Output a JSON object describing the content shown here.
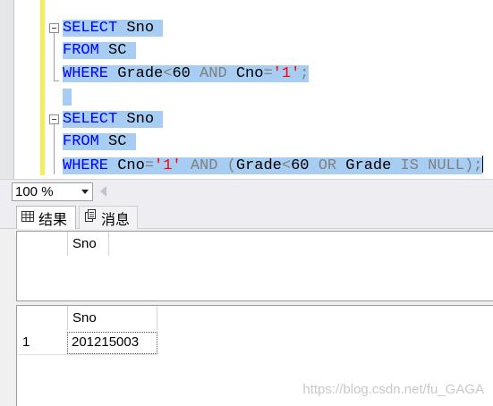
{
  "editor": {
    "block1": {
      "line1": {
        "kw": "SELECT",
        "rest": " Sno "
      },
      "line2": {
        "kw": "FROM",
        "rest": " SC "
      },
      "line3": {
        "kw": "WHERE",
        "t1": " Grade",
        "op1": "<",
        "t2": "60 ",
        "kw2": "AND",
        "t3": " Cno",
        "op2": "=",
        "str": "'1'",
        "op3": ";"
      }
    },
    "block2": {
      "line1": {
        "kw": "SELECT",
        "rest": " Sno "
      },
      "line2": {
        "kw": "FROM",
        "rest": " SC "
      },
      "line3": {
        "kw": "WHERE",
        "t1": " Cno",
        "op1": "=",
        "str": "'1'",
        "sp1": " ",
        "kw2": "AND",
        "op2": " (",
        "t2": "Grade",
        "op3": "<",
        "t3": "60 ",
        "kw3": "OR",
        "t4": " Grade ",
        "kw4": "IS NULL",
        "op4": ");"
      }
    }
  },
  "status": {
    "zoom": "100 %"
  },
  "tabs": {
    "results": "结果",
    "messages": "消息"
  },
  "results": {
    "grid1": {
      "columns": [
        "Sno"
      ]
    },
    "grid2": {
      "columns": [
        "Sno"
      ],
      "rows": [
        {
          "num": "1",
          "sno": "201215003"
        }
      ]
    }
  },
  "watermark": "https://blog.csdn.net/fu_GAGA"
}
